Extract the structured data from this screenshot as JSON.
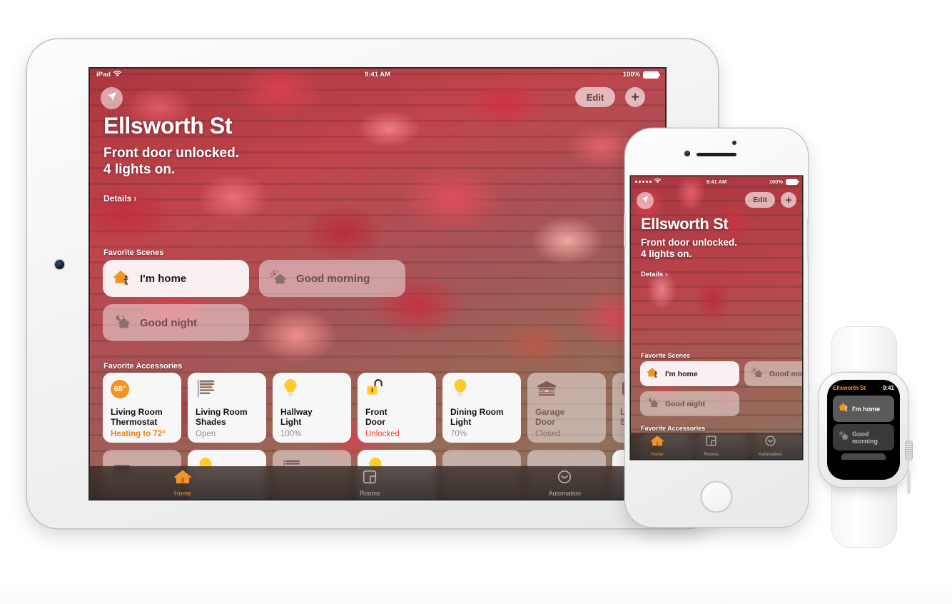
{
  "app": {
    "name": "Home"
  },
  "ipad": {
    "status_bar": {
      "carrier": "iPad",
      "wifi_icon": "wifi-icon",
      "time": "9:41 AM",
      "battery_percent": "100%"
    },
    "nav": {
      "location_icon": "location-arrow-icon",
      "edit_label": "Edit",
      "add_icon": "plus-icon"
    },
    "header": {
      "title": "Ellsworth St",
      "status_line_1": "Front door unlocked.",
      "status_line_2": "4 lights on.",
      "details_label": "Details",
      "details_chevron": "chevron-right-icon"
    },
    "scenes_section_label": "Favorite Scenes",
    "scenes": [
      {
        "label": "I'm home",
        "icon": "house-person-icon",
        "state": "active"
      },
      {
        "label": "Good morning",
        "icon": "sun-house-icon",
        "state": "dim"
      },
      {
        "label": "Good night",
        "icon": "moon-house-icon",
        "state": "dim"
      }
    ],
    "accessories_section_label": "Favorite Accessories",
    "accessories": [
      {
        "name": "Living Room\nThermostat",
        "state": "Heating to 72°",
        "icon": "thermostat-icon",
        "badge": "68°",
        "on": true,
        "state_color": "#f08a1e"
      },
      {
        "name": "Living Room\nShades",
        "state": "Open",
        "icon": "shades-icon",
        "on": true,
        "state_color": "#8e8e93"
      },
      {
        "name": "Hallway\nLight",
        "state": "100%",
        "icon": "lightbulb-icon",
        "on": true,
        "state_color": "#8e8e93"
      },
      {
        "name": "Front\nDoor",
        "state": "Unlocked",
        "icon": "unlocked-padlock-icon",
        "on": true,
        "state_color": "#ff3b30"
      },
      {
        "name": "Dining Room\nLight",
        "state": "70%",
        "icon": "lightbulb-icon",
        "on": true,
        "state_color": "#8e8e93"
      },
      {
        "name": "Garage\nDoor",
        "state": "Closed",
        "icon": "garage-door-icon",
        "on": false,
        "state_color": "#8a6a66"
      },
      {
        "name": "Living Roo\nSmoke Det",
        "state": "",
        "icon": "smoke-detector-icon",
        "on": false,
        "state_color": "#8a6a66"
      }
    ],
    "tabs": [
      {
        "label": "Home",
        "icon": "house-icon",
        "active": true
      },
      {
        "label": "Rooms",
        "icon": "rooms-icon",
        "active": false
      },
      {
        "label": "Automation",
        "icon": "clock-icon",
        "active": false
      }
    ]
  },
  "iphone": {
    "status_bar": {
      "signal_icon": "signal-dots-icon",
      "wifi_icon": "wifi-icon",
      "time": "9:41 AM",
      "battery_percent": "100%"
    },
    "nav": {
      "location_icon": "location-arrow-icon",
      "edit_label": "Edit",
      "add_icon": "plus-icon"
    },
    "header": {
      "title": "Ellsworth St",
      "status_line_1": "Front door unlocked.",
      "status_line_2": "4 lights on.",
      "details_label": "Details",
      "details_chevron": "chevron-right-icon"
    },
    "scenes_section_label": "Favorite Scenes",
    "scenes": [
      {
        "label": "I'm home",
        "icon": "house-person-icon",
        "state": "active"
      },
      {
        "label": "Good mo",
        "icon": "sun-house-icon",
        "state": "dim"
      },
      {
        "label": "Good night",
        "icon": "moon-house-icon",
        "state": "dim"
      }
    ],
    "accessories_section_label": "Favorite Accessories",
    "tabs": [
      {
        "label": "Home",
        "icon": "house-icon",
        "active": true
      },
      {
        "label": "Rooms",
        "icon": "rooms-icon",
        "active": false
      },
      {
        "label": "Automation",
        "icon": "clock-icon",
        "active": false
      }
    ]
  },
  "watch": {
    "home_name": "Ellsworth St",
    "time": "9:41",
    "scenes": [
      {
        "label": "I'm home",
        "icon": "house-person-icon",
        "state": "active"
      },
      {
        "label": "Good morning",
        "icon": "sun-house-icon",
        "state": "dim"
      }
    ]
  },
  "colors": {
    "accent_orange": "#f0932a",
    "alert_red": "#ff3b30",
    "pink_tile": "#f0a8ab",
    "background": "#ffffff"
  }
}
